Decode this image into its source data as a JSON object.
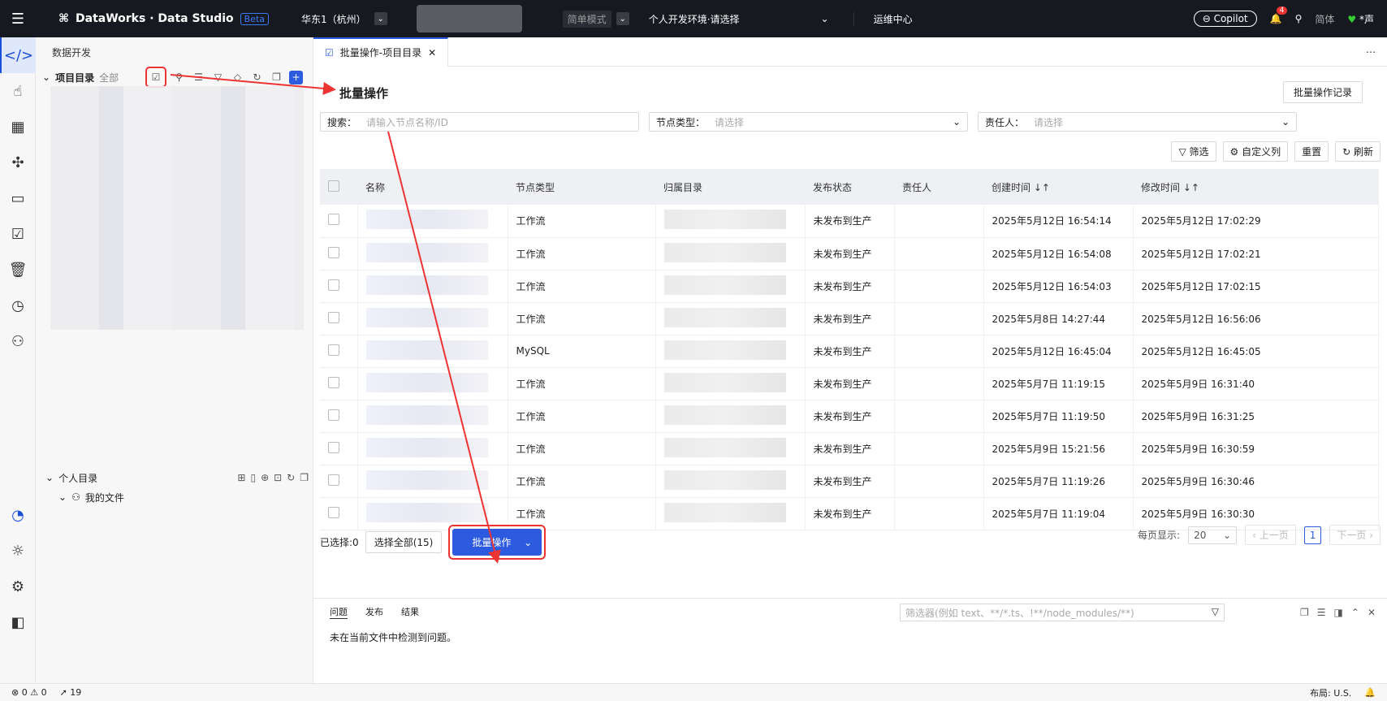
{
  "topbar": {
    "brand": "DataWorks · Data Studio",
    "beta": "Beta",
    "region": "华东1（杭州）",
    "mode": "简单模式",
    "env": "个人开发环境·请选择",
    "ops": "运维中心",
    "copilot": "Copilot",
    "notif": "4",
    "lang": "简体",
    "user": "*声"
  },
  "left": {
    "title": "数据开发",
    "project_label": "项目目录",
    "project_scope": "全部",
    "personal_label": "个人目录",
    "my_files": "我的文件"
  },
  "tab": {
    "title": "批量操作-项目目录"
  },
  "main": {
    "heading": "批量操作",
    "record_btn": "批量操作记录",
    "filters": {
      "search_label": "搜索：",
      "search_ph": "请输入节点名称/ID",
      "type_label": "节点类型：",
      "type_ph": "请选择",
      "owner_label": "责任人：",
      "owner_ph": "请选择"
    },
    "tools": {
      "filter": "筛选",
      "custom": "自定义列",
      "reset": "重置",
      "refresh": "刷新"
    },
    "columns": [
      "名称",
      "节点类型",
      "归属目录",
      "发布状态",
      "责任人",
      "创建时间",
      "修改时间"
    ],
    "rows": [
      {
        "type": "工作流",
        "status": "未发布到生产",
        "created": "2025年5月12日 16:54:14",
        "modified": "2025年5月12日 17:02:29"
      },
      {
        "type": "工作流",
        "status": "未发布到生产",
        "created": "2025年5月12日 16:54:08",
        "modified": "2025年5月12日 17:02:21"
      },
      {
        "type": "工作流",
        "status": "未发布到生产",
        "created": "2025年5月12日 16:54:03",
        "modified": "2025年5月12日 17:02:15"
      },
      {
        "type": "工作流",
        "status": "未发布到生产",
        "created": "2025年5月8日 14:27:44",
        "modified": "2025年5月12日 16:56:06"
      },
      {
        "type": "MySQL",
        "status": "未发布到生产",
        "created": "2025年5月12日 16:45:04",
        "modified": "2025年5月12日 16:45:05"
      },
      {
        "type": "工作流",
        "status": "未发布到生产",
        "created": "2025年5月7日 11:19:15",
        "modified": "2025年5月9日 16:31:40"
      },
      {
        "type": "工作流",
        "status": "未发布到生产",
        "created": "2025年5月7日 11:19:50",
        "modified": "2025年5月9日 16:31:25"
      },
      {
        "type": "工作流",
        "status": "未发布到生产",
        "created": "2025年5月9日 15:21:56",
        "modified": "2025年5月9日 16:30:59"
      },
      {
        "type": "工作流",
        "status": "未发布到生产",
        "created": "2025年5月7日 11:19:26",
        "modified": "2025年5月9日 16:30:46"
      },
      {
        "type": "工作流",
        "status": "未发布到生产",
        "created": "2025年5月7日 11:19:04",
        "modified": "2025年5月9日 16:30:30"
      }
    ],
    "footer": {
      "selected": "已选择:0",
      "select_all": "选择全部(15)",
      "batch": "批量操作",
      "per_page": "每页显示:",
      "page_size": "20",
      "prev": "上一页",
      "page": "1",
      "next": "下一页"
    }
  },
  "bottom": {
    "tabs": [
      "问题",
      "发布",
      "结果"
    ],
    "filter_ph": "筛选器(例如 text、**/*.ts、!**/node_modules/**)",
    "message": "未在当前文件中检测到问题。"
  },
  "status": {
    "errors": "0",
    "warnings": "0",
    "sent": "19",
    "layout": "布局: U.S."
  }
}
